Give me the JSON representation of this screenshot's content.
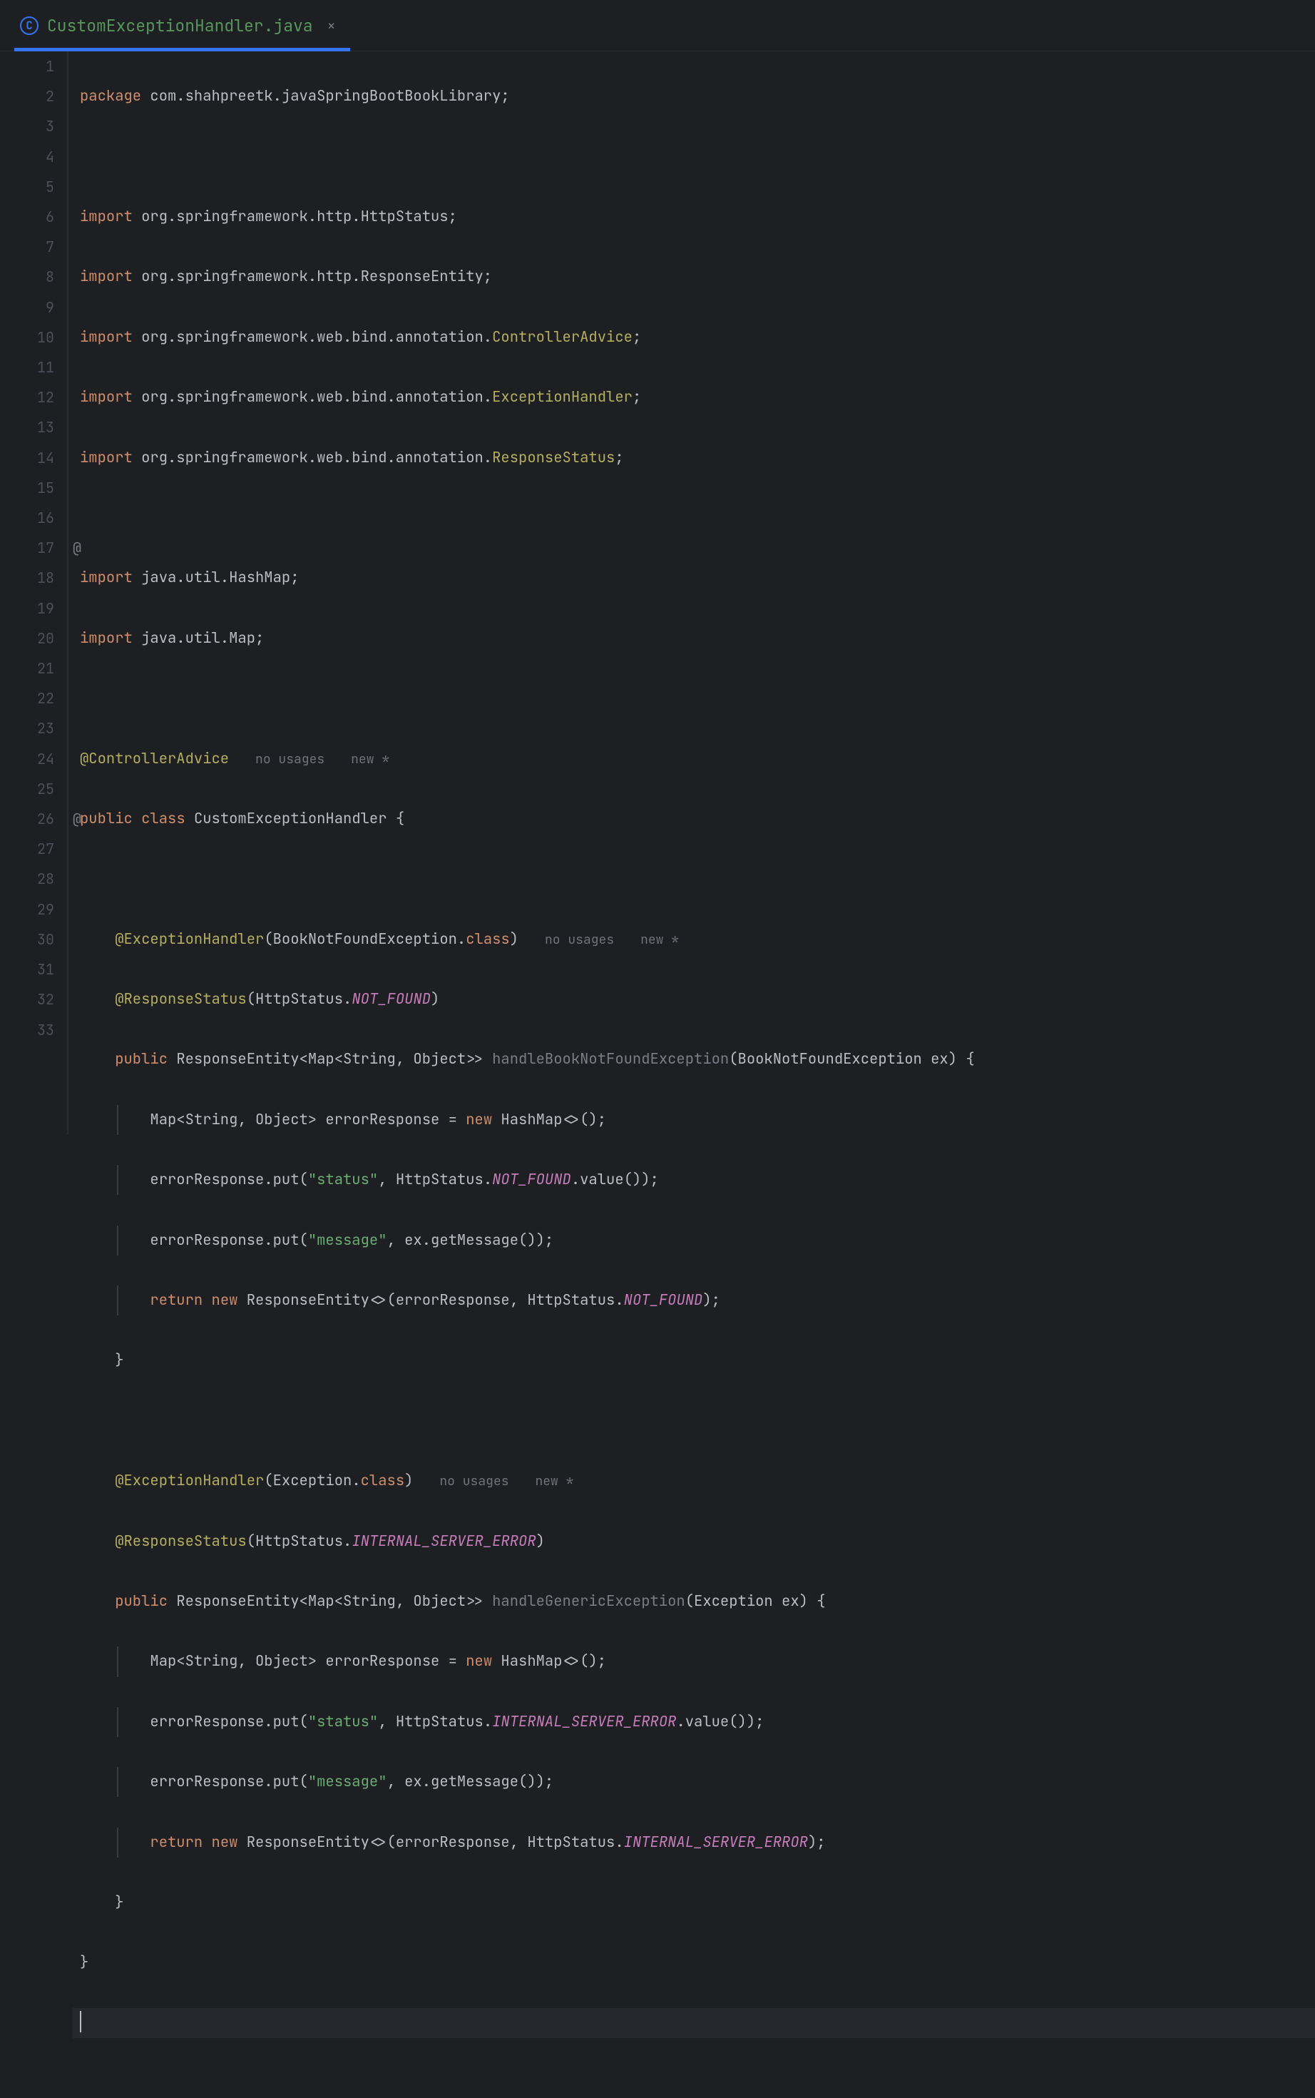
{
  "tab": {
    "icon_letter": "C",
    "filename": "CustomExceptionHandler.java",
    "close_glyph": "×"
  },
  "gutter_marks": {
    "line17": "@",
    "line26": "@"
  },
  "hints": {
    "no_usages": "no usages",
    "new_star": "new *"
  },
  "code": {
    "l1_kw": "package",
    "l1_pkg": " com.shahpreetk.javaSpringBootBookLibrary;",
    "l3_kw": "import",
    "l3_pkg": " org.springframework.http.HttpStatus;",
    "l4_kw": "import",
    "l4_pkg": " org.springframework.http.ResponseEntity;",
    "l5_kw": "import",
    "l5_pkg": " org.springframework.web.bind.annotation.",
    "l5_cls": "ControllerAdvice",
    "l5_end": ";",
    "l6_kw": "import",
    "l6_pkg": " org.springframework.web.bind.annotation.",
    "l6_cls": "ExceptionHandler",
    "l6_end": ";",
    "l7_kw": "import",
    "l7_pkg": " org.springframework.web.bind.annotation.",
    "l7_cls": "ResponseStatus",
    "l7_end": ";",
    "l9_kw": "import",
    "l9_pkg": " java.util.HashMap;",
    "l10_kw": "import",
    "l10_pkg": " java.util.Map;",
    "l12_ann": "@ControllerAdvice",
    "l13_kw1": "public",
    "l13_kw2": "class",
    "l13_name": "CustomExceptionHandler",
    "l13_brace": " {",
    "l15_ann": "@ExceptionHandler",
    "l15_paren1": "(",
    "l15_arg": "BookNotFoundException.",
    "l15_kw": "class",
    "l15_paren2": ")",
    "l16_ann": "@ResponseStatus",
    "l16_paren1": "(",
    "l16_arg": "HttpStatus.",
    "l16_const": "NOT_FOUND",
    "l16_paren2": ")",
    "l17_kw": "public",
    "l17_type": " ResponseEntity<Map<String, Object>> ",
    "l17_fn": "handleBookNotFoundException",
    "l17_params": "(BookNotFoundException ex) {",
    "l18_a": "Map<String, Object> errorResponse = ",
    "l18_kw": "new",
    "l18_b": " HashMap<>();",
    "l19_a": "errorResponse.put(",
    "l19_str": "\"status\"",
    "l19_b": ", HttpStatus.",
    "l19_const": "NOT_FOUND",
    "l19_c": ".value());",
    "l20_a": "errorResponse.put(",
    "l20_str": "\"message\"",
    "l20_b": ", ex.getMessage());",
    "l21_kw1": "return",
    "l21_kw2": "new",
    "l21_a": " ResponseEntity<>(errorResponse, HttpStatus.",
    "l21_const": "NOT_FOUND",
    "l21_b": ");",
    "l22_brace": "}",
    "l24_ann": "@ExceptionHandler",
    "l24_paren1": "(",
    "l24_arg": "Exception.",
    "l24_kw": "class",
    "l24_paren2": ")",
    "l25_ann": "@ResponseStatus",
    "l25_paren1": "(",
    "l25_arg": "HttpStatus.",
    "l25_const": "INTERNAL_SERVER_ERROR",
    "l25_paren2": ")",
    "l26_kw": "public",
    "l26_type": " ResponseEntity<Map<String, Object>> ",
    "l26_fn": "handleGenericException",
    "l26_params": "(Exception ex) {",
    "l27_a": "Map<String, Object> errorResponse = ",
    "l27_kw": "new",
    "l27_b": " HashMap<>();",
    "l28_a": "errorResponse.put(",
    "l28_str": "\"status\"",
    "l28_b": ", HttpStatus.",
    "l28_const": "INTERNAL_SERVER_ERROR",
    "l28_c": ".value());",
    "l29_a": "errorResponse.put(",
    "l29_str": "\"message\"",
    "l29_b": ", ex.getMessage());",
    "l30_kw1": "return",
    "l30_kw2": "new",
    "l30_a": " ResponseEntity<>(errorResponse, HttpStatus.",
    "l30_const": "INTERNAL_SERVER_ERROR",
    "l30_b": ");",
    "l31_brace": "}",
    "l32_brace": "}"
  },
  "line_numbers": [
    "1",
    "2",
    "3",
    "4",
    "5",
    "6",
    "7",
    "8",
    "9",
    "10",
    "11",
    "12",
    "13",
    "14",
    "15",
    "16",
    "17",
    "18",
    "19",
    "20",
    "21",
    "22",
    "23",
    "24",
    "25",
    "26",
    "27",
    "28",
    "29",
    "30",
    "31",
    "32",
    "33"
  ]
}
